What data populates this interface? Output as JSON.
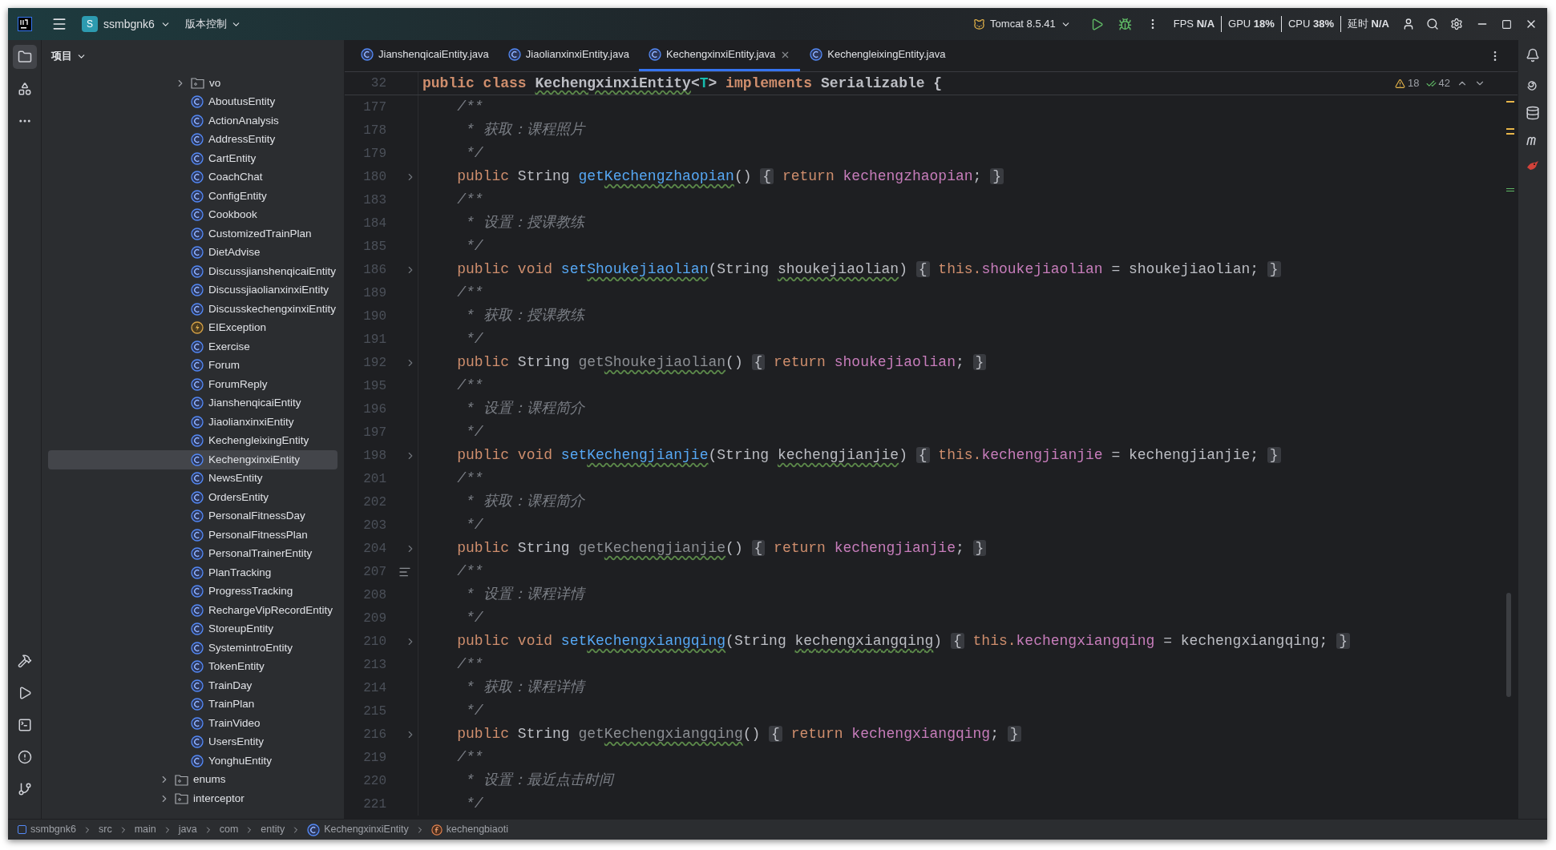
{
  "title_bar": {
    "project_badge": "S",
    "project": "ssmbgnk6",
    "vcs": "版本控制",
    "run_config": "Tomcat 8.5.41",
    "perf": [
      {
        "label": "FPS",
        "value": "N/A"
      },
      {
        "label": "GPU",
        "value": "18%"
      },
      {
        "label": "CPU",
        "value": "38%"
      },
      {
        "label": "延时",
        "value": "N/A"
      }
    ]
  },
  "left_toolbar": {
    "top": [
      {
        "kind": "folder",
        "selected": true
      },
      {
        "kind": "structure",
        "selected": false
      },
      {
        "kind": "more",
        "selected": false
      }
    ],
    "bottom": [
      {
        "kind": "build"
      },
      {
        "kind": "services"
      },
      {
        "kind": "terminal"
      },
      {
        "kind": "problems"
      },
      {
        "kind": "git"
      }
    ]
  },
  "project_panel": {
    "title": "项目",
    "tree": [
      {
        "children": [
          {
            "label": "vo",
            "kind": "folder",
            "expanded": false,
            "selected": false
          },
          {
            "label": "AboutusEntity",
            "kind": "class",
            "selected": false
          },
          {
            "label": "ActionAnalysis",
            "kind": "class",
            "selected": false
          },
          {
            "label": "AddressEntity",
            "kind": "class",
            "selected": false
          },
          {
            "label": "CartEntity",
            "kind": "class",
            "selected": false
          },
          {
            "label": "CoachChat",
            "kind": "class",
            "selected": false
          },
          {
            "label": "ConfigEntity",
            "kind": "class",
            "selected": false
          },
          {
            "label": "Cookbook",
            "kind": "class",
            "selected": false
          },
          {
            "label": "CustomizedTrainPlan",
            "kind": "class",
            "selected": false
          },
          {
            "label": "DietAdvise",
            "kind": "class",
            "selected": false
          },
          {
            "label": "DiscussjianshenqicaiEntity",
            "kind": "class",
            "selected": false
          },
          {
            "label": "DiscussjiaolianxinxiEntity",
            "kind": "class",
            "selected": false
          },
          {
            "label": "DiscusskechengxinxiEntity",
            "kind": "class",
            "selected": false
          },
          {
            "label": "EIException",
            "kind": "exception",
            "selected": false
          },
          {
            "label": "Exercise",
            "kind": "class",
            "selected": false
          },
          {
            "label": "Forum",
            "kind": "class",
            "selected": false
          },
          {
            "label": "ForumReply",
            "kind": "class",
            "selected": false
          },
          {
            "label": "JianshenqicaiEntity",
            "kind": "class",
            "selected": false
          },
          {
            "label": "JiaolianxinxiEntity",
            "kind": "class",
            "selected": false
          },
          {
            "label": "KechengleixingEntity",
            "kind": "class",
            "selected": false
          },
          {
            "label": "KechengxinxiEntity",
            "kind": "class",
            "selected": true
          },
          {
            "label": "NewsEntity",
            "kind": "class",
            "selected": false
          },
          {
            "label": "OrdersEntity",
            "kind": "class",
            "selected": false
          },
          {
            "label": "PersonalFitnessDay",
            "kind": "class",
            "selected": false
          },
          {
            "label": "PersonalFitnessPlan",
            "kind": "class",
            "selected": false
          },
          {
            "label": "PersonalTrainerEntity",
            "kind": "class",
            "selected": false
          },
          {
            "label": "PlanTracking",
            "kind": "class",
            "selected": false
          },
          {
            "label": "ProgressTracking",
            "kind": "class",
            "selected": false
          },
          {
            "label": "RechargeVipRecordEntity",
            "kind": "class",
            "selected": false
          },
          {
            "label": "StoreupEntity",
            "kind": "class",
            "selected": false
          },
          {
            "label": "SystemintroEntity",
            "kind": "class",
            "selected": false
          },
          {
            "label": "TokenEntity",
            "kind": "class",
            "selected": false
          },
          {
            "label": "TrainDay",
            "kind": "class",
            "selected": false
          },
          {
            "label": "TrainPlan",
            "kind": "class",
            "selected": false
          },
          {
            "label": "TrainVideo",
            "kind": "class",
            "selected": false
          },
          {
            "label": "UsersEntity",
            "kind": "class",
            "selected": false
          },
          {
            "label": "YonghuEntity",
            "kind": "class",
            "selected": false
          }
        ]
      },
      {
        "label": "enums",
        "kind": "folder",
        "expanded": false,
        "selected": false
      },
      {
        "label": "interceptor",
        "kind": "folder",
        "expanded": false,
        "selected": false
      }
    ]
  },
  "tabs": [
    {
      "label": "JianshenqicaiEntity.java",
      "selected": false
    },
    {
      "label": "JiaolianxinxiEntity.java",
      "selected": false
    },
    {
      "label": "KechengxinxiEntity.java",
      "selected": true
    },
    {
      "label": "KechengleixingEntity.java",
      "selected": false
    }
  ],
  "inspections": {
    "warnings": "18",
    "passed": "42"
  },
  "code": [
    {
      "number": "32",
      "sticky": true,
      "tokens": [
        {
          "text": "public class ",
          "kind": "keyword"
        },
        {
          "text": "KechengxinxiEntity",
          "kind": "plain",
          "typo": true
        },
        {
          "text": "<",
          "kind": "plain"
        },
        {
          "text": "T",
          "kind": "typeparam"
        },
        {
          "text": "> ",
          "kind": "plain"
        },
        {
          "text": "implements ",
          "kind": "keyword"
        },
        {
          "text": "Serializable {",
          "kind": "plain"
        }
      ]
    },
    {
      "number": "177",
      "tokens": [
        {
          "text": "    /**",
          "kind": "comment"
        }
      ]
    },
    {
      "number": "178",
      "tokens": [
        {
          "text": "     * 获取：课程照片",
          "kind": "comment"
        }
      ]
    },
    {
      "number": "179",
      "tokens": [
        {
          "text": "     */",
          "kind": "comment"
        }
      ]
    },
    {
      "number": "180",
      "fold": true,
      "tokens": [
        {
          "text": "    public ",
          "kind": "keyword"
        },
        {
          "text": "String ",
          "kind": "plain"
        },
        {
          "text": "get",
          "kind": "method"
        },
        {
          "text": "Kechengzhaopian",
          "kind": "method",
          "typo": true
        },
        {
          "text": "() ",
          "kind": "plain"
        },
        {
          "text": "{",
          "kind": "brace"
        },
        {
          "text": " return ",
          "kind": "keyword"
        },
        {
          "text": "kechengzhaopian",
          "kind": "field"
        },
        {
          "text": "; ",
          "kind": "plain"
        },
        {
          "text": "}",
          "kind": "brace"
        }
      ]
    },
    {
      "number": "183",
      "tokens": [
        {
          "text": "    /**",
          "kind": "comment"
        }
      ]
    },
    {
      "number": "184",
      "tokens": [
        {
          "text": "     * 设置：授课教练",
          "kind": "comment"
        }
      ]
    },
    {
      "number": "185",
      "tokens": [
        {
          "text": "     */",
          "kind": "comment"
        }
      ]
    },
    {
      "number": "186",
      "fold": true,
      "tokens": [
        {
          "text": "    public ",
          "kind": "keyword"
        },
        {
          "text": "void ",
          "kind": "keyword"
        },
        {
          "text": "set",
          "kind": "method"
        },
        {
          "text": "Shoukejiaolian",
          "kind": "method",
          "typo": true
        },
        {
          "text": "(String ",
          "kind": "plain"
        },
        {
          "text": "shoukejiaolian",
          "kind": "plain",
          "typo": true
        },
        {
          "text": ") ",
          "kind": "plain"
        },
        {
          "text": "{",
          "kind": "brace"
        },
        {
          "text": " this.",
          "kind": "keyword"
        },
        {
          "text": "shoukejiaolian",
          "kind": "field"
        },
        {
          "text": " = shoukejiaolian; ",
          "kind": "plain"
        },
        {
          "text": "}",
          "kind": "brace"
        }
      ]
    },
    {
      "number": "189",
      "tokens": [
        {
          "text": "    /**",
          "kind": "comment"
        }
      ]
    },
    {
      "number": "190",
      "tokens": [
        {
          "text": "     * 获取：授课教练",
          "kind": "comment"
        }
      ]
    },
    {
      "number": "191",
      "tokens": [
        {
          "text": "     */",
          "kind": "comment"
        }
      ]
    },
    {
      "number": "192",
      "fold": true,
      "tokens": [
        {
          "text": "    public ",
          "kind": "keyword"
        },
        {
          "text": "String ",
          "kind": "plain"
        },
        {
          "text": "get",
          "kind": "unused"
        },
        {
          "text": "Shoukejiaolian",
          "kind": "unused",
          "typo": true
        },
        {
          "text": "() ",
          "kind": "plain"
        },
        {
          "text": "{",
          "kind": "brace"
        },
        {
          "text": " return ",
          "kind": "keyword"
        },
        {
          "text": "shoukejiaolian",
          "kind": "field"
        },
        {
          "text": "; ",
          "kind": "plain"
        },
        {
          "text": "}",
          "kind": "brace"
        }
      ]
    },
    {
      "number": "195",
      "tokens": [
        {
          "text": "    /**",
          "kind": "comment"
        }
      ]
    },
    {
      "number": "196",
      "tokens": [
        {
          "text": "     * 设置：课程简介",
          "kind": "comment"
        }
      ]
    },
    {
      "number": "197",
      "tokens": [
        {
          "text": "     */",
          "kind": "comment"
        }
      ]
    },
    {
      "number": "198",
      "fold": true,
      "tokens": [
        {
          "text": "    public ",
          "kind": "keyword"
        },
        {
          "text": "void ",
          "kind": "keyword"
        },
        {
          "text": "set",
          "kind": "method"
        },
        {
          "text": "Kechengjianjie",
          "kind": "method",
          "typo": true
        },
        {
          "text": "(String ",
          "kind": "plain"
        },
        {
          "text": "kechengjianjie",
          "kind": "plain",
          "typo": true
        },
        {
          "text": ") ",
          "kind": "plain"
        },
        {
          "text": "{",
          "kind": "brace"
        },
        {
          "text": " this.",
          "kind": "keyword"
        },
        {
          "text": "kechengjianjie",
          "kind": "field"
        },
        {
          "text": " = kechengjianjie; ",
          "kind": "plain"
        },
        {
          "text": "}",
          "kind": "brace"
        }
      ]
    },
    {
      "number": "201",
      "tokens": [
        {
          "text": "    /**",
          "kind": "comment"
        }
      ]
    },
    {
      "number": "202",
      "tokens": [
        {
          "text": "     * 获取：课程简介",
          "kind": "comment"
        }
      ]
    },
    {
      "number": "203",
      "tokens": [
        {
          "text": "     */",
          "kind": "comment"
        }
      ]
    },
    {
      "number": "204",
      "fold": true,
      "tokens": [
        {
          "text": "    public ",
          "kind": "keyword"
        },
        {
          "text": "String ",
          "kind": "plain"
        },
        {
          "text": "get",
          "kind": "unused"
        },
        {
          "text": "Kechengjianjie",
          "kind": "unused",
          "typo": true
        },
        {
          "text": "() ",
          "kind": "plain"
        },
        {
          "text": "{",
          "kind": "brace"
        },
        {
          "text": " return ",
          "kind": "keyword"
        },
        {
          "text": "kechengjianjie",
          "kind": "field"
        },
        {
          "text": "; ",
          "kind": "plain"
        },
        {
          "text": "}",
          "kind": "brace"
        }
      ]
    },
    {
      "number": "207",
      "doc": true,
      "tokens": [
        {
          "text": "    /**",
          "kind": "comment"
        }
      ]
    },
    {
      "number": "208",
      "tokens": [
        {
          "text": "     * 设置：课程详情",
          "kind": "comment"
        }
      ]
    },
    {
      "number": "209",
      "tokens": [
        {
          "text": "     */",
          "kind": "comment"
        }
      ]
    },
    {
      "number": "210",
      "fold": true,
      "tokens": [
        {
          "text": "    public ",
          "kind": "keyword"
        },
        {
          "text": "void ",
          "kind": "keyword"
        },
        {
          "text": "set",
          "kind": "method"
        },
        {
          "text": "Kechengxiangqing",
          "kind": "method",
          "typo": true
        },
        {
          "text": "(String ",
          "kind": "plain"
        },
        {
          "text": "kechengxiangqing",
          "kind": "plain",
          "typo": true
        },
        {
          "text": ") ",
          "kind": "plain"
        },
        {
          "text": "{",
          "kind": "brace"
        },
        {
          "text": " this.",
          "kind": "keyword"
        },
        {
          "text": "kechengxiangqing",
          "kind": "field"
        },
        {
          "text": " = kechengxiangqing; ",
          "kind": "plain"
        },
        {
          "text": "}",
          "kind": "brace"
        }
      ]
    },
    {
      "number": "213",
      "tokens": [
        {
          "text": "    /**",
          "kind": "comment"
        }
      ]
    },
    {
      "number": "214",
      "tokens": [
        {
          "text": "     * 获取：课程详情",
          "kind": "comment"
        }
      ]
    },
    {
      "number": "215",
      "tokens": [
        {
          "text": "     */",
          "kind": "comment"
        }
      ]
    },
    {
      "number": "216",
      "fold": true,
      "tokens": [
        {
          "text": "    public ",
          "kind": "keyword"
        },
        {
          "text": "String ",
          "kind": "plain"
        },
        {
          "text": "get",
          "kind": "unused"
        },
        {
          "text": "Kechengxiangqing",
          "kind": "unused",
          "typo": true
        },
        {
          "text": "() ",
          "kind": "plain"
        },
        {
          "text": "{",
          "kind": "brace"
        },
        {
          "text": " return ",
          "kind": "keyword"
        },
        {
          "text": "kechengxiangqing",
          "kind": "field"
        },
        {
          "text": "; ",
          "kind": "plain"
        },
        {
          "text": "}",
          "kind": "brace"
        }
      ]
    },
    {
      "number": "219",
      "tokens": [
        {
          "text": "    /**",
          "kind": "comment"
        }
      ]
    },
    {
      "number": "220",
      "tokens": [
        {
          "text": "     * 设置：最近点击时间",
          "kind": "comment"
        }
      ]
    },
    {
      "number": "221",
      "tokens": [
        {
          "text": "     */",
          "kind": "comment"
        }
      ]
    }
  ],
  "breadcrumbs": [
    {
      "label": "ssmbgnk6",
      "kind": "module"
    },
    {
      "label": "src",
      "kind": "plain"
    },
    {
      "label": "main",
      "kind": "plain"
    },
    {
      "label": "java",
      "kind": "plain"
    },
    {
      "label": "com",
      "kind": "plain"
    },
    {
      "label": "entity",
      "kind": "plain"
    },
    {
      "label": "KechengxinxiEntity",
      "kind": "class"
    },
    {
      "label": "kechengbiaoti",
      "kind": "field"
    }
  ]
}
